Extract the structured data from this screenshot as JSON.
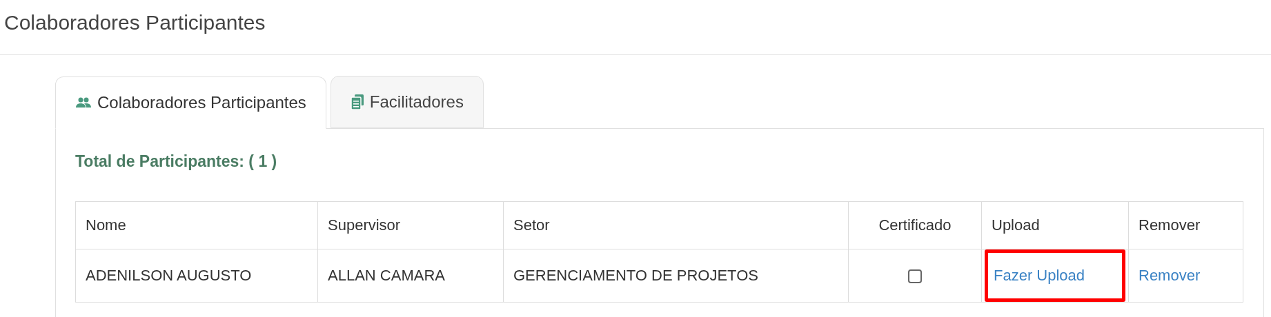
{
  "page_title": "Colaboradores Participantes",
  "tabs": [
    {
      "label": "Colaboradores Participantes",
      "selected": true
    },
    {
      "label": "Facilitadores",
      "selected": false
    }
  ],
  "total_label": "Total de Participantes: ( 1 )",
  "table": {
    "columns": [
      "Nome",
      "Supervisor",
      "Setor",
      "Certificado",
      "Upload",
      "Remover"
    ],
    "rows": [
      {
        "nome": "ADENILSON AUGUSTO",
        "supervisor": "ALLAN CAMARA",
        "setor": "GERENCIAMENTO DE PROJETOS",
        "certificado": false,
        "upload": {
          "label": "Fazer Upload",
          "highlighted": true
        },
        "remover": "Remover"
      }
    ]
  }
}
